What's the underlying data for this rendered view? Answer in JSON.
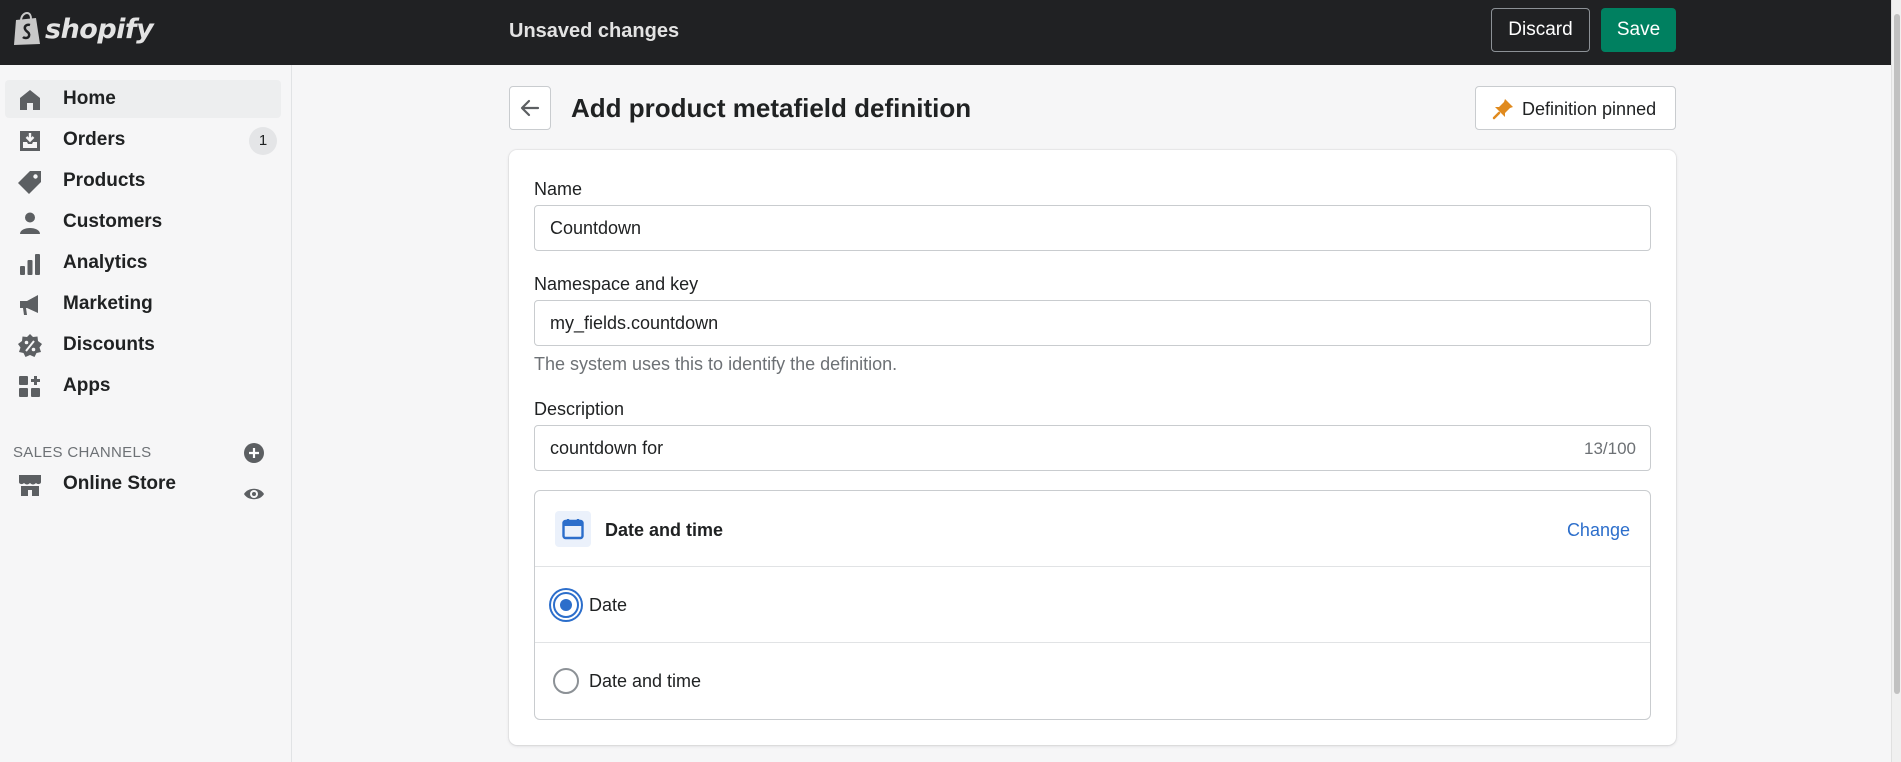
{
  "topbar": {
    "logo_text": "shopify",
    "status": "Unsaved changes",
    "discard_label": "Discard",
    "save_label": "Save"
  },
  "sidebar": {
    "items": [
      {
        "label": "Home",
        "icon": "home-icon",
        "active": true
      },
      {
        "label": "Orders",
        "icon": "orders-icon",
        "badge": "1"
      },
      {
        "label": "Products",
        "icon": "tag-icon"
      },
      {
        "label": "Customers",
        "icon": "person-icon"
      },
      {
        "label": "Analytics",
        "icon": "bar-chart-icon"
      },
      {
        "label": "Marketing",
        "icon": "megaphone-icon"
      },
      {
        "label": "Discounts",
        "icon": "discount-icon"
      },
      {
        "label": "Apps",
        "icon": "apps-icon"
      }
    ],
    "section_title": "SALES CHANNELS",
    "channels": [
      {
        "label": "Online Store",
        "icon": "store-icon"
      }
    ]
  },
  "page": {
    "title": "Add product metafield definition",
    "pin_label": "Definition pinned",
    "form": {
      "name_label": "Name",
      "name_value": "Countdown",
      "key_label": "Namespace and key",
      "key_value": "my_fields.countdown",
      "key_help": "The system uses this to identify the definition.",
      "description_label": "Description",
      "description_value": "countdown for",
      "description_counter": "13/100"
    },
    "type": {
      "title": "Date and time",
      "change_label": "Change",
      "options": [
        {
          "label": "Date",
          "checked": true
        },
        {
          "label": "Date and time",
          "checked": false
        }
      ]
    }
  },
  "colors": {
    "topbar_bg": "#202123",
    "save_green": "#008060",
    "link_blue": "#2c6ecb",
    "pin_orange": "#e08a1e"
  }
}
